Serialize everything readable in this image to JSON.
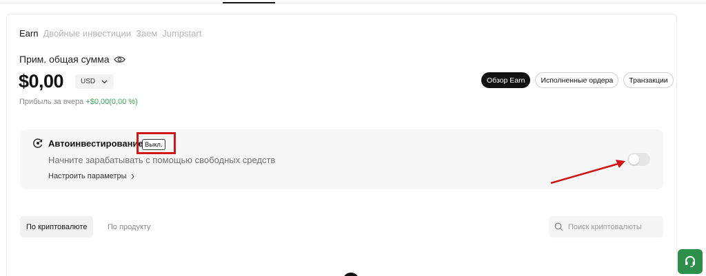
{
  "tabs": [
    {
      "label": "Earn",
      "active": true
    },
    {
      "label": "Двойные инвестиции",
      "active": false
    },
    {
      "label": "Заем",
      "active": false
    },
    {
      "label": "Jumpstart",
      "active": false
    }
  ],
  "summary": {
    "estimated_label": "Прим. общая сумма",
    "balance": "$0,00",
    "currency": "USD",
    "profit_label": "Прибыль за вчера",
    "profit_value": "+$0,00(0,00 %)"
  },
  "pills": {
    "overview": "Обзор Earn",
    "orders": "Исполненные ордера",
    "transactions": "Транзакции"
  },
  "auto_invest": {
    "title": "Автоинвестирование",
    "status": "Выкл.",
    "description": "Начните зарабатывать с помощью свободных средств",
    "settings_link": "Настроить параметры",
    "enabled": false
  },
  "view_tabs": {
    "by_crypto": "По криптовалюте",
    "by_product": "По продукту"
  },
  "search": {
    "placeholder": "Поиск криптовалюты"
  },
  "colors": {
    "gain": "#3aa656",
    "annotation": "#d01717",
    "support": "#2d8f49"
  }
}
